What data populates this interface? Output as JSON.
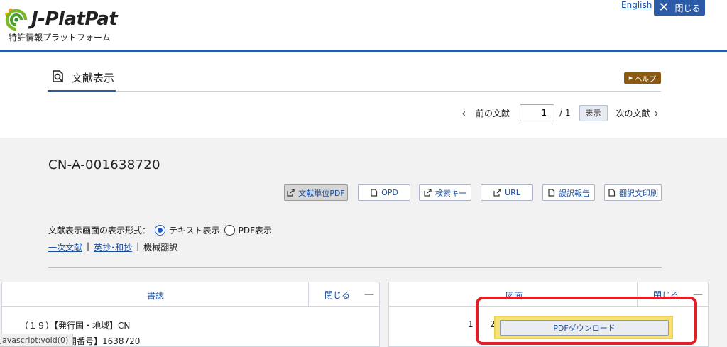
{
  "header": {
    "logo_text": "J-PlatPat",
    "logo_subtitle": "特許情報プラットフォーム",
    "lang_link": "English",
    "close_label": "閉じる"
  },
  "page": {
    "title": "文献表示",
    "help_label": "ヘルプ"
  },
  "pager": {
    "prev_label": "前の文献",
    "current_page": "1",
    "total": "/ 1",
    "show_label": "表示",
    "next_label": "次の文献"
  },
  "document": {
    "id": "CN-A-001638720",
    "tools": [
      {
        "label": "文献単位PDF",
        "icon": "external-link-icon"
      },
      {
        "label": "OPD",
        "icon": "document-icon"
      },
      {
        "label": "検索キー",
        "icon": "external-link-icon"
      },
      {
        "label": "URL",
        "icon": "external-link-icon"
      },
      {
        "label": "誤訳報告",
        "icon": "document-icon"
      },
      {
        "label": "翻訳文印刷",
        "icon": "document-icon"
      }
    ],
    "format_label": "文献表示画面の表示形式：",
    "format_text": "テキスト表示",
    "format_pdf": "PDF表示",
    "view_primary": "一次文献",
    "view_abstract": "英抄･和抄",
    "view_machine": "機械翻訳",
    "sep": "|"
  },
  "left_panel": {
    "title": "書誌",
    "close_label": "閉じる",
    "minus": "—",
    "rows": [
      "（１９）【発行国・地域】CN",
      "【公開番号】1638720"
    ]
  },
  "right_panel": {
    "title": "図面",
    "close_label": "閉じる",
    "minus": "—",
    "row_number": "1",
    "row_fragment": "2"
  },
  "overlay": {
    "pdf_download_label": "PDFダウンロード"
  },
  "status_bar": {
    "url": "javascript:void(0)"
  },
  "colors": {
    "brand_blue": "#2c5aa0",
    "link_blue": "#1a4ea0",
    "help_brown": "#8a5a14",
    "highlight_red": "#e21f26",
    "highlight_yellow": "#f5e27a"
  }
}
